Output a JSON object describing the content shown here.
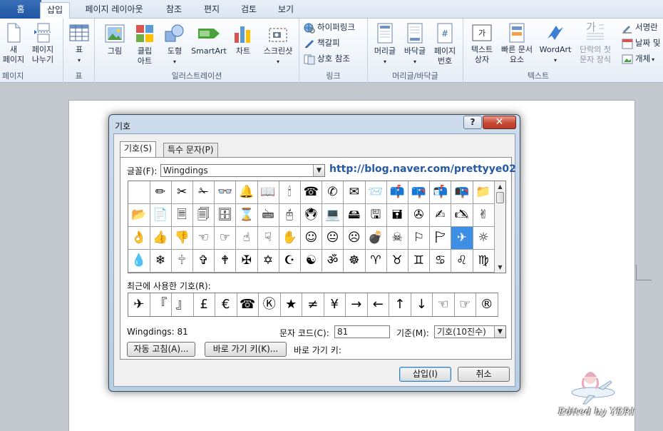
{
  "ribbon": {
    "tabs": [
      "홈",
      "삽입",
      "페이지 레이아웃",
      "참조",
      "편지",
      "검토",
      "보기"
    ],
    "active_tab": "삽입",
    "groups": {
      "pages": {
        "title": "페이지",
        "new_page": [
          "새",
          "페이지"
        ],
        "page_break": [
          "페이지",
          "나누기"
        ]
      },
      "table": {
        "title": "표",
        "table": "표"
      },
      "illustrations": {
        "title": "일러스트레이션",
        "picture": "그림",
        "clipart": [
          "클립",
          "아트"
        ],
        "shapes": "도형",
        "smartart": "SmartArt",
        "chart": "차트",
        "screenshot": "스크린샷"
      },
      "links": {
        "title": "링크",
        "hyperlink": "하이퍼링크",
        "bookmark": "책갈피",
        "cross_ref": "상호 참조"
      },
      "header_footer": {
        "title": "머리글/바닥글",
        "header": "머리글",
        "footer": "바닥글",
        "page_number": [
          "페이지",
          "번호"
        ]
      },
      "text": {
        "title": "텍스트",
        "textbox": [
          "텍스트",
          "상자"
        ],
        "quickparts": [
          "빠른 문서",
          "요소"
        ],
        "wordart": "WordArt",
        "dropcap": [
          "단락의 첫",
          "문자 장식"
        ],
        "signature": "서명란",
        "datetime": "날짜 및",
        "object": "개체"
      }
    }
  },
  "dialog": {
    "title": "기호",
    "help": "?",
    "close": "✕",
    "tabs": [
      "기호(S)",
      "특수 문자(P)"
    ],
    "font_label": "글꼴(F):",
    "font_value": "Wingdings",
    "url": "http://blog.naver.com/prettyye02",
    "symbols": [
      [
        "",
        "✏",
        "✂",
        "✁",
        "👓",
        "🔔",
        "📖",
        "🕯",
        "☎",
        "✆",
        "✉",
        "📨",
        "📫",
        "📪",
        "📬",
        "📭",
        "📁"
      ],
      [
        "📂",
        "📄",
        "🗏",
        "🗐",
        "🗄",
        "⌛",
        "🖮",
        "🖰",
        "🖲",
        "💻",
        "🖴",
        "🖫",
        "🖬",
        "✇",
        "✍",
        "🖎",
        "✌"
      ],
      [
        "👌",
        "👍",
        "👎",
        "☜",
        "☞",
        "☝",
        "☟",
        "✋",
        "☺",
        "😐",
        "☹",
        "💣",
        "☠",
        "⚐",
        "🏱",
        "✈",
        "☼"
      ],
      [
        "💧",
        "❄",
        "🕆",
        "✞",
        "🕈",
        "✠",
        "✡",
        "☪",
        "☯",
        "ॐ",
        "☸",
        "♈",
        "♉",
        "♊",
        "♋",
        "♌",
        "♍"
      ]
    ],
    "selected_symbol": "✈",
    "recent_label": "최근에 사용한 기호(R):",
    "recent": [
      "✈",
      "『",
      "』",
      "£",
      "€",
      "☎",
      "Ⓚ",
      "★",
      "≠",
      "¥",
      "→",
      "←",
      "↑",
      "↓",
      "☜",
      "☞",
      "®"
    ],
    "char_name": "Wingdings: 81",
    "char_code_label": "문자 코드(C):",
    "char_code_value": "81",
    "from_label": "기준(M):",
    "from_value": "기호(10진수)",
    "autocorrect_btn": "자동 고침(A)...",
    "shortcut_btn": "바로 가기 키(K)...",
    "shortcut_label": "바로 가기 키:",
    "insert_btn": "삽입(I)",
    "cancel_btn": "취소"
  },
  "watermark": "Edited by YERI"
}
